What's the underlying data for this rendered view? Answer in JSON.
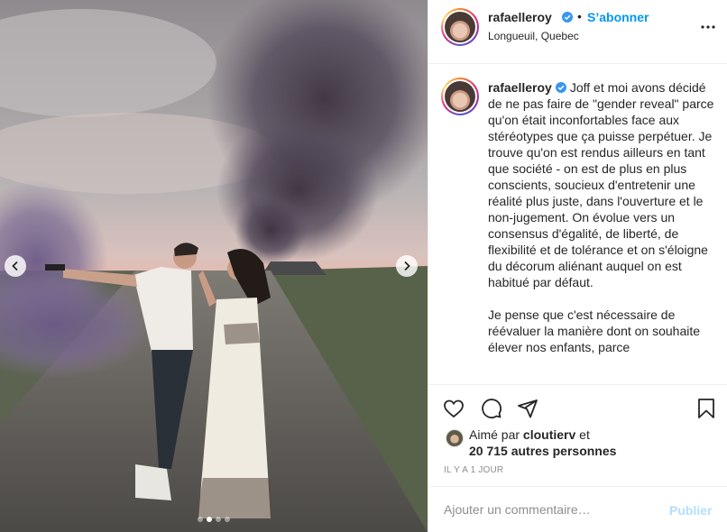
{
  "post": {
    "username": "rafaelleroy",
    "follow_label": "S’abonner",
    "location": "Longueuil, Quebec",
    "caption_paragraphs": [
      "Joff et moi avons décidé de ne pas faire de \"gender reveal\" parce qu'on était inconfortables face aux stéréotypes que ça puisse perpétuer. Je trouve qu'on est rendus ailleurs en tant que société - on est de plus en plus conscients, soucieux d'entretenir une réalité plus juste, dans l'ouverture et le non-jugement. On évolue vers un consensus d'égalité, de liberté, de flexibilité et de tolérance et on s'éloigne du décorum aliénant auquel on est habitué par défaut.",
      "Je pense que c'est nécessaire de réévaluer la manière dont on souhaite élever nos enfants, parce"
    ],
    "likes_prefix": "Aimé par",
    "liker_username": "cloutierv",
    "likes_joiner": "et",
    "likes_others": "20 715 autres personnes",
    "timestamp": "Il y a 1 jour",
    "comment_placeholder": "Ajouter un commentaire…",
    "post_label": "Publier"
  },
  "carousel": {
    "slide_count": 4,
    "active_index": 1
  },
  "icons": {
    "verified": "verified-badge-icon",
    "more": "more-options-icon",
    "like": "heart-icon",
    "comment": "comment-bubble-icon",
    "share": "paper-plane-icon",
    "save": "bookmark-icon",
    "prev": "chevron-left-icon",
    "next": "chevron-right-icon"
  },
  "colors": {
    "accent": "#0095f6",
    "accent_disabled": "#b2dffc",
    "text": "#262626",
    "muted": "#8e8e8e",
    "border": "#efefef",
    "verified": "#3897f0"
  }
}
